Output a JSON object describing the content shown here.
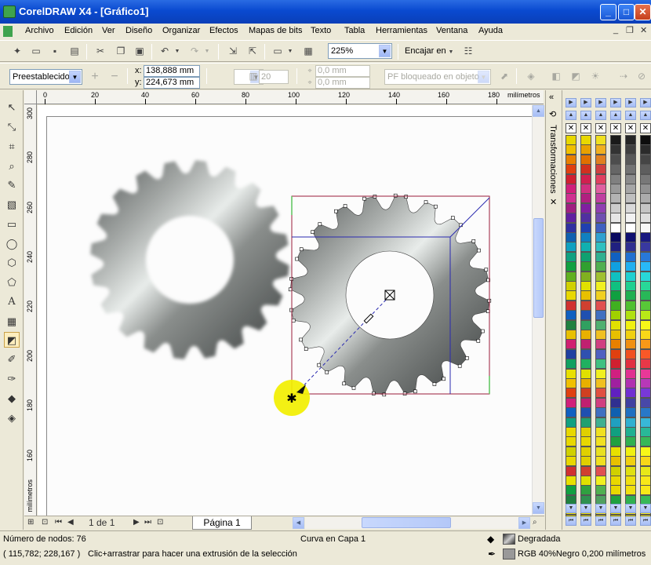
{
  "window": {
    "title": "CorelDRAW X4 - [Gráfico1]"
  },
  "menu": [
    "Archivo",
    "Edición",
    "Ver",
    "Diseño",
    "Organizar",
    "Efectos",
    "Mapas de bits",
    "Texto",
    "Tabla",
    "Herramientas",
    "Ventana",
    "Ayuda"
  ],
  "toolbar": {
    "zoom_value": "225%",
    "snap_label": "Encajar en"
  },
  "propertybar": {
    "preset_value": "Preestablecidos",
    "x_label": "x:",
    "x_value": "138,888 mm",
    "y_label": "y:",
    "y_value": "224,673 mm",
    "depth_value": "20",
    "rot_x": "0,0 mm",
    "rot_y": "0,0 mm",
    "vp_lock": "PF bloqueado en objeto"
  },
  "rulers": {
    "unit": "milímetros",
    "h_labels": [
      "0",
      "20",
      "40",
      "60",
      "80",
      "100",
      "120",
      "140",
      "160",
      "180"
    ],
    "v_labels": [
      "300",
      "280",
      "260",
      "240",
      "220",
      "200",
      "180",
      "160"
    ],
    "v_unit": "milímetros"
  },
  "pagenav": {
    "page_count": "1 de 1",
    "page_tab": "Página 1"
  },
  "docker": {
    "title": "Transformaciones"
  },
  "status": {
    "nodes": "Número de nodos: 76",
    "curve_layer": "Curva en Capa 1",
    "coords": "( 115,782; 228,167 )",
    "hint": "Clic+arrastrar para hacer una extrusión de la selección",
    "fill": "Degradada",
    "outline": "RGB 40%Negro  0,200 milímetros"
  },
  "colors": {
    "palette_col1": [
      "#e8d800",
      "#f0c000",
      "#e88000",
      "#e04010",
      "#d02030",
      "#d0207a",
      "#d03090",
      "#a02080",
      "#6020a0",
      "#3030a0",
      "#1060b0",
      "#10a0c0",
      "#10a080",
      "#10a040",
      "#60b020",
      "#d0d000",
      "#e8d800",
      "#d03030",
      "#1060c0",
      "#208040",
      "#e8c000",
      "#d02070",
      "#2040a0",
      "#10a060",
      "#e8e000",
      "#f0c000",
      "#e04010",
      "#d0207a",
      "#1060c0",
      "#10a080",
      "#e8d800",
      "#e8d800",
      "#d0d000",
      "#e8d800",
      "#d03030",
      "#e8e000",
      "#10a040",
      "#208040",
      "#e8d800",
      "#e8d800"
    ],
    "palette_col2": [
      "#e8d800",
      "#e8a000",
      "#e07000",
      "#d03020",
      "#d02050",
      "#d03080",
      "#b02080",
      "#8020a0",
      "#5030a0",
      "#2040b0",
      "#1080c0",
      "#10b0b0",
      "#10a070",
      "#30a030",
      "#80b020",
      "#e0e000",
      "#e8c000",
      "#d04030",
      "#2050b0",
      "#30a060",
      "#e8b000",
      "#c02070",
      "#3050b0",
      "#20b060",
      "#e0e000",
      "#e8b000",
      "#d04020",
      "#c02070",
      "#2050b0",
      "#20a070",
      "#e0d000",
      "#e8d800",
      "#e0d000",
      "#e0d000",
      "#d04030",
      "#e0e000",
      "#30a040",
      "#309050",
      "#e8d800",
      "#e8d800"
    ],
    "palette_col3": [
      "#f0e020",
      "#f0b020",
      "#e08020",
      "#d04040",
      "#e04060",
      "#e060a0",
      "#c040a0",
      "#9040b0",
      "#7050b0",
      "#4060c0",
      "#30a0d0",
      "#30c0c0",
      "#30b090",
      "#50b050",
      "#a0c030",
      "#f0f020",
      "#f0d020",
      "#e05050",
      "#4070c0",
      "#50b070",
      "#f0c020",
      "#d04080",
      "#5060c0",
      "#40c080",
      "#f0f020",
      "#f0c020",
      "#e05040",
      "#d04080",
      "#4070c0",
      "#40b090",
      "#f0e020",
      "#f0e020",
      "#e8e020",
      "#f0e020",
      "#e05050",
      "#f0f020",
      "#50b050",
      "#50a060",
      "#f0e020",
      "#f0e020"
    ],
    "palette_col4": [
      "#1a1a1a",
      "#333333",
      "#4d4d4d",
      "#666666",
      "#808080",
      "#999999",
      "#b3b3b3",
      "#cccccc",
      "#e6e6e6",
      "#ffffff",
      "#0a0a60",
      "#202080",
      "#1060c0",
      "#10a0e0",
      "#10c0c0",
      "#10c080",
      "#10a040",
      "#40b020",
      "#a0d000",
      "#e0e000",
      "#e8c000",
      "#e88000",
      "#e04010",
      "#d02030",
      "#d02080",
      "#a020a0",
      "#6020c0",
      "#303090",
      "#1060b0",
      "#20a0c0",
      "#10a080",
      "#20a040",
      "#e8e000",
      "#e8c000",
      "#d0d000",
      "#e8d800",
      "#e8d800",
      "#20a040",
      "#e8d800",
      "#e8d800"
    ],
    "palette_col5": [
      "#262626",
      "#404040",
      "#595959",
      "#737373",
      "#8c8c8c",
      "#a6a6a6",
      "#bfbfbf",
      "#d9d9d9",
      "#f2f2f2",
      "#ffffff",
      "#101070",
      "#303090",
      "#2070d0",
      "#20b0f0",
      "#20d0d0",
      "#20d090",
      "#20b050",
      "#50c030",
      "#b0e010",
      "#f0f010",
      "#f0d010",
      "#f09010",
      "#f05020",
      "#e03040",
      "#e03090",
      "#b030b0",
      "#7030d0",
      "#4040a0",
      "#2070c0",
      "#30b0d0",
      "#20b090",
      "#30b050",
      "#f0f010",
      "#f0d010",
      "#e0e010",
      "#f0e010",
      "#f0e010",
      "#30b050",
      "#f0e010",
      "#f0e010"
    ],
    "palette_col6": [
      "#0d0d0d",
      "#2b2b2b",
      "#454545",
      "#5e5e5e",
      "#787878",
      "#919191",
      "#ababab",
      "#c4c4c4",
      "#dedede",
      "#f7f7f7",
      "#181880",
      "#3838a0",
      "#2878d8",
      "#28b8f8",
      "#28d8d8",
      "#28d898",
      "#28b858",
      "#58c838",
      "#b8e818",
      "#f8f818",
      "#f8d818",
      "#f89818",
      "#f85828",
      "#e83848",
      "#e83898",
      "#b838b8",
      "#7838d8",
      "#4848a8",
      "#2878c8",
      "#38b8d8",
      "#28b898",
      "#38b858",
      "#f8f818",
      "#f8d818",
      "#e8e818",
      "#f8e818",
      "#f8e818",
      "#38b858",
      "#f8e818",
      "#f8e818"
    ]
  }
}
